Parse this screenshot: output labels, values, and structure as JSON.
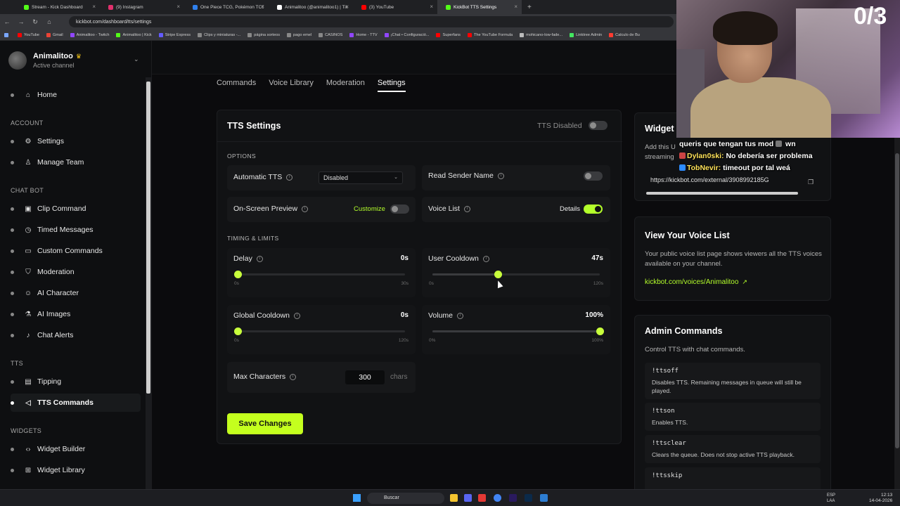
{
  "browser": {
    "tabs": [
      {
        "title": "Stream - Kick Dashboard",
        "color": "#53fc18"
      },
      {
        "title": "(9) Instagram",
        "color": "#e1306c"
      },
      {
        "title": "One Piece TCG, Pokémon TCG",
        "color": "#2f80ed"
      },
      {
        "title": "Animalitoo (@animalitoo1) | TikTok",
        "color": "#ffffff"
      },
      {
        "title": "(3) YouTube",
        "color": "#ff0000"
      },
      {
        "title": "KickBot TTS Settings",
        "color": "#53fc18"
      }
    ],
    "url": "kickbot.com/dashboard/tts/settings",
    "bookmarks": [
      "YouTube",
      "Gmail",
      "Animalitoo - Twitch",
      "Animalitoo | Kick",
      "Stripe Express",
      "Clips y miniaturas -...",
      "página sorteos",
      "pago emel",
      "CASINOS",
      "Home - TTV",
      "¡Chat • Configuració...",
      "Superfans",
      "The YouTube Formula",
      "mohicano-low-fade...",
      "Linktree Admin",
      "Calculo de Bu"
    ]
  },
  "sidebar": {
    "channel_name": "Animalitoo",
    "channel_status": "Active channel",
    "home": "Home",
    "sections": {
      "account": "ACCOUNT",
      "chat_bot": "CHAT BOT",
      "tts": "TTS",
      "widgets": "WIDGETS"
    },
    "items": {
      "settings": "Settings",
      "manage_team": "Manage Team",
      "clip_command": "Clip Command",
      "timed_messages": "Timed Messages",
      "custom_commands": "Custom Commands",
      "moderation": "Moderation",
      "ai_character": "AI Character",
      "ai_images": "AI Images",
      "chat_alerts": "Chat Alerts",
      "tipping": "Tipping",
      "tts_commands": "TTS Commands",
      "widget_builder": "Widget Builder",
      "widget_library": "Widget Library"
    }
  },
  "main_tabs": {
    "commands": "Commands",
    "voice_library": "Voice Library",
    "moderation": "Moderation",
    "settings": "Settings"
  },
  "tts": {
    "title": "TTS Settings",
    "status_label": "TTS Disabled",
    "options_label": "OPTIONS",
    "automatic_tts": "Automatic TTS",
    "automatic_tts_value": "Disabled",
    "read_sender_name": "Read Sender Name",
    "on_screen_preview": "On-Screen Preview",
    "customize": "Customize",
    "voice_list": "Voice List",
    "details": "Details",
    "timing_label": "TIMING & LIMITS",
    "delay": {
      "label": "Delay",
      "value": "0s",
      "min": "0s",
      "max": "30s",
      "fraction": 0
    },
    "user_cooldown": {
      "label": "User Cooldown",
      "value": "47s",
      "min": "0s",
      "max": "120s",
      "fraction": 0.39
    },
    "global_cooldown": {
      "label": "Global Cooldown",
      "value": "0s",
      "min": "0s",
      "max": "120s",
      "fraction": 0
    },
    "volume": {
      "label": "Volume",
      "value": "100%",
      "min": "0%",
      "max": "100%",
      "fraction": 1
    },
    "max_characters": "Max Characters",
    "max_characters_value": "300",
    "chars_unit": "chars",
    "save": "Save Changes"
  },
  "widget": {
    "title": "Widget",
    "desc": "Add this U",
    "desc2": "streaming",
    "url": "https://kickbot.com/external/3908992185G"
  },
  "voice_list_card": {
    "title": "View Your Voice List",
    "desc": "Your public voice list page shows viewers all the TTS voices available on your channel.",
    "link": "kickbot.com/voices/Animalitoo"
  },
  "admin": {
    "title": "Admin Commands",
    "desc": "Control TTS with chat commands.",
    "commands": [
      {
        "name": "!ttsoff",
        "desc": "Disables TTS. Remaining messages in queue will still be played."
      },
      {
        "name": "!ttson",
        "desc": "Enables TTS."
      },
      {
        "name": "!ttsclear",
        "desc": "Clears the queue. Does not stop active TTS playback."
      },
      {
        "name": "!ttsskip",
        "desc": ""
      }
    ]
  },
  "overlay": {
    "counter": "0/3",
    "chat": [
      {
        "user": "",
        "text": "queris que tengan tus mod",
        "suffix": "wn"
      },
      {
        "user": "Dylan0ski:",
        "text": "No debería ser problema",
        "suffix": ""
      },
      {
        "user": "TobNevir:",
        "text": "timeout por tal weá",
        "suffix": ""
      }
    ]
  },
  "taskbar": {
    "search": "Buscar",
    "lang1": "ESP",
    "lang2": "LAA",
    "time": "12:13",
    "date": "14-04-2026"
  },
  "colors": {
    "accent": "#b4ff2b",
    "save_button": "#c4ff1e"
  }
}
